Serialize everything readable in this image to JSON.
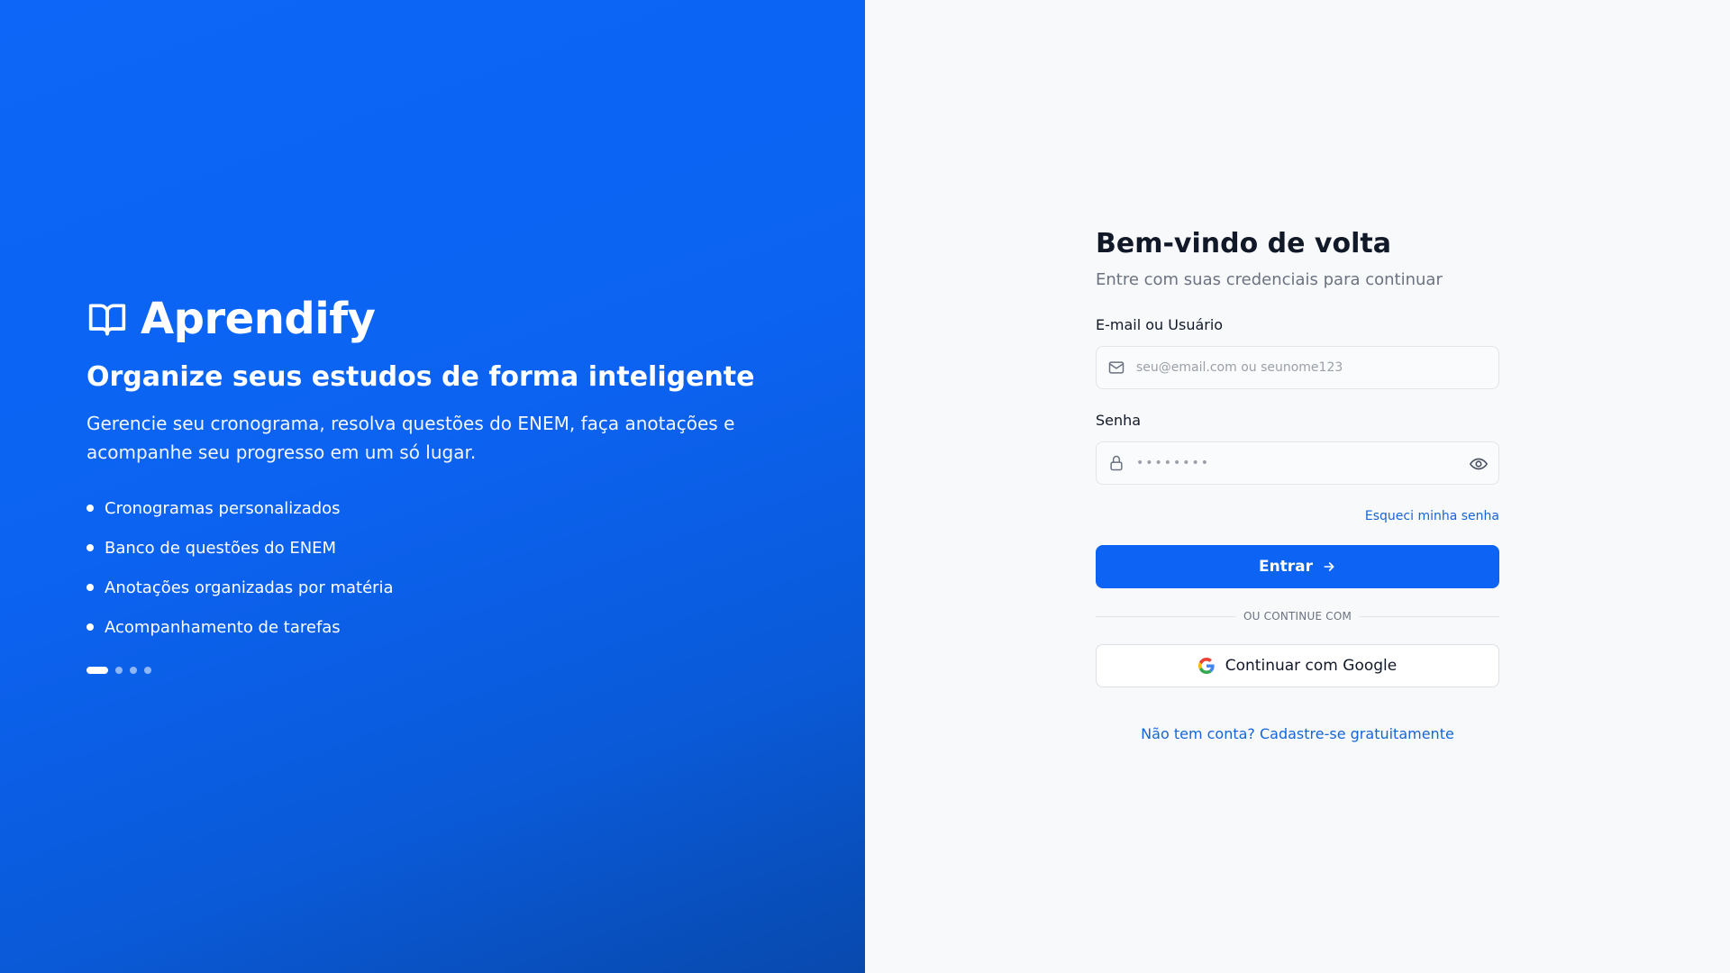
{
  "hero": {
    "brand_icon": "open-book-icon",
    "brand_name": "Aprendify",
    "tagline": "Organize seus estudos de forma inteligente",
    "description": "Gerencie seu cronograma, resolva questões do ENEM, faça anotações e acompanhe seu progresso em um só lugar.",
    "features": [
      {
        "label": "Cronogramas personalizados"
      },
      {
        "label": "Banco de questões do ENEM"
      },
      {
        "label": "Anotações organizadas por matéria"
      },
      {
        "label": "Acompanhamento de tarefas"
      }
    ],
    "carousel": {
      "slides": 4,
      "active": 1
    },
    "colors": {
      "gradient_start": "#0d66f7",
      "gradient_end": "#0849ad"
    }
  },
  "auth": {
    "title": "Bem-vindo de volta",
    "subtitle": "Entre com suas credenciais para continuar",
    "email": {
      "label": "E-mail ou Usuário",
      "placeholder": "seu@email.com ou seunome123",
      "value": "",
      "icon": "mail-icon"
    },
    "password": {
      "label": "Senha",
      "placeholder": "••••••••",
      "value": "",
      "icon": "lock-icon",
      "toggle_icon": "eye-icon"
    },
    "forgot_password": "Esqueci minha senha",
    "submit": {
      "label": "Entrar",
      "icon": "arrow-right-icon"
    },
    "divider": "OU CONTINUE COM",
    "google": {
      "label": "Continuar com Google",
      "icon": "google-icon"
    },
    "signup": "Não tem conta? Cadastre-se gratuitamente",
    "colors": {
      "accent": "#0d63f3",
      "link": "#1565d8",
      "background": "#f8f9fb"
    }
  }
}
